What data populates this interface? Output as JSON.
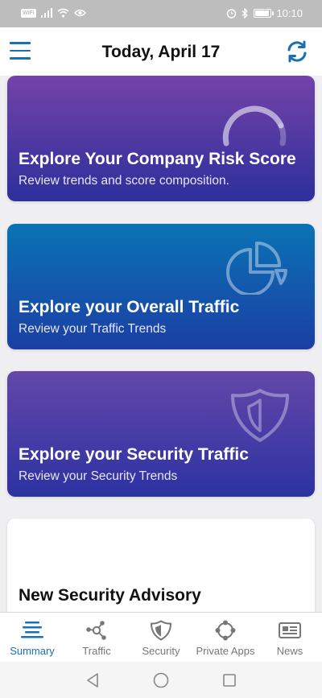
{
  "status": {
    "wifi_label": "WiFi",
    "time": "10:10"
  },
  "header": {
    "title": "Today, April 17"
  },
  "cards": [
    {
      "title": "Explore Your Company Risk Score",
      "subtitle": "Review trends and score composition."
    },
    {
      "title": "Explore your Overall Traffic",
      "subtitle": "Review your Traffic Trends"
    },
    {
      "title": "Explore your Security Traffic",
      "subtitle": "Review your Security Trends"
    }
  ],
  "advisory": {
    "title": "New Security Advisory"
  },
  "nav": {
    "items": [
      {
        "label": "Summary",
        "icon": "summary-icon",
        "active": true
      },
      {
        "label": "Traffic",
        "icon": "network-icon"
      },
      {
        "label": "Security",
        "icon": "shield-icon"
      },
      {
        "label": "Private Apps",
        "icon": "nodes-icon"
      },
      {
        "label": "News",
        "icon": "newspaper-icon"
      }
    ]
  },
  "colors": {
    "accent": "#1b6fb3",
    "card_purple_top": "#7443a8",
    "card_blue_top": "#0a73b5",
    "card_indigo_bottom": "#2c2f9c"
  }
}
